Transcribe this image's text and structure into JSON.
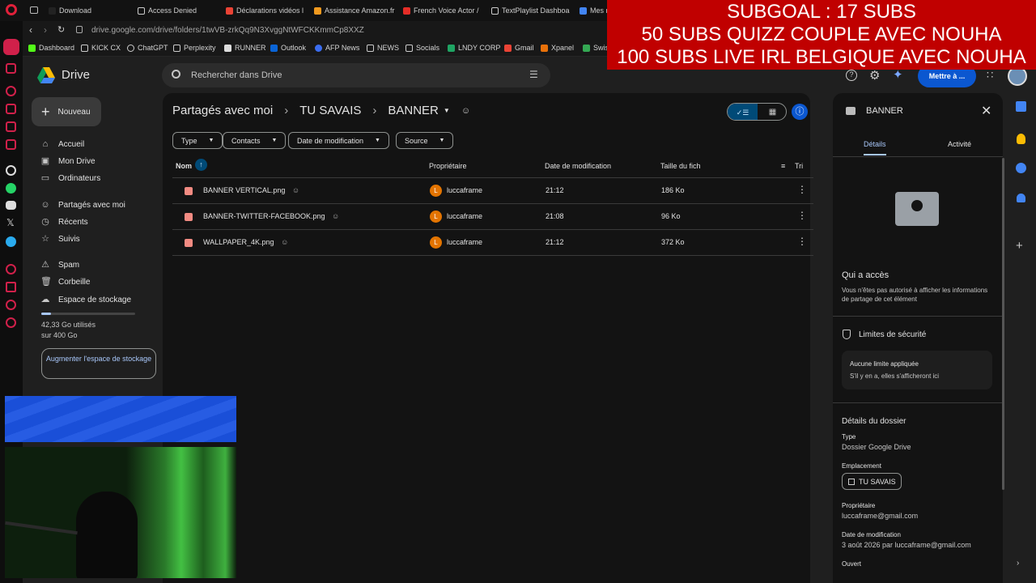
{
  "browser": {
    "tabs": [
      "Download",
      "Access Denied",
      "Déclarations vidéos l",
      "Assistance Amazon.fr",
      "French Voice Actor / ",
      "TextPlaylist Dashboa",
      "Mes r"
    ],
    "url": "drive.google.com/drive/folders/1twVB-zrkQq9N3XvggNtWFCKKmmCp8XXZ",
    "bookmarks": [
      "Dashboard",
      "KICK CX",
      "ChatGPT",
      "Perplexity",
      "RUNNER",
      "Outlook",
      "AFP News",
      "NEWS",
      "Socials",
      "LNDY CORP",
      "Gmail",
      "Xpanel",
      "Swis"
    ]
  },
  "overlay": {
    "lines": [
      "SUBGOAL : 17 SUBS",
      "50 SUBS QUIZZ COUPLE AVEC NOUHA",
      "100 SUBS LIVE IRL BELGIQUE AVEC NOUHA"
    ]
  },
  "drive": {
    "app_name": "Drive",
    "search_placeholder": "Rechercher dans Drive",
    "share_button": "Mettre à ...",
    "new_button": "Nouveau",
    "nav": [
      "Accueil",
      "Mon Drive",
      "Ordinateurs",
      "Partagés avec moi",
      "Récents",
      "Suivis",
      "Spam",
      "Corbeille",
      "Espace de stockage"
    ],
    "storage": {
      "text": "42,33 Go utilisés\nsur 400 Go",
      "used_fraction": 0.106
    },
    "more_storage": "Augmenter l'espace de stockage",
    "breadcrumb": [
      "Partagés avec moi",
      "TU SAVAIS",
      "BANNER"
    ],
    "filters": [
      "Type",
      "Contacts",
      "Date de modification",
      "Source"
    ],
    "columns": {
      "name": "Nom",
      "owner": "Propriétaire",
      "modified": "Date de modification",
      "size": "Taille du fich",
      "sort": "Tri"
    },
    "files": [
      {
        "name": "BANNER VERTICAL.png",
        "owner": "luccaframe",
        "avatar": "L",
        "modified": "21:12",
        "size": "186 Ko"
      },
      {
        "name": "BANNER-TWITTER-FACEBOOK.png",
        "owner": "luccaframe",
        "avatar": "L",
        "modified": "21:08",
        "size": "96 Ko"
      },
      {
        "name": "WALLPAPER_4K.png",
        "owner": "luccaframe",
        "avatar": "L",
        "modified": "21:12",
        "size": "372 Ko"
      }
    ]
  },
  "details": {
    "title": "BANNER",
    "tabs": [
      "Détails",
      "Activité"
    ],
    "access_title": "Qui a accès",
    "access_text": "Vous n'êtes pas autorisé à afficher les informations de partage de cet élément",
    "security_title": "Limites de sécurité",
    "security_box_title": "Aucune limite appliquée",
    "security_box_text": "S'il y en a, elles s'afficheront ici",
    "folder_details": "Détails du dossier",
    "type_label": "Type",
    "type_value": "Dossier Google Drive",
    "location_label": "Emplacement",
    "location_value": "TU SAVAIS",
    "owner_label": "Propriétaire",
    "owner_value": "luccaframe@gmail.com",
    "modified_label": "Date de modification",
    "modified_value": "3 août 2026 par luccaframe@gmail.com",
    "opened_label": "Ouvert"
  }
}
